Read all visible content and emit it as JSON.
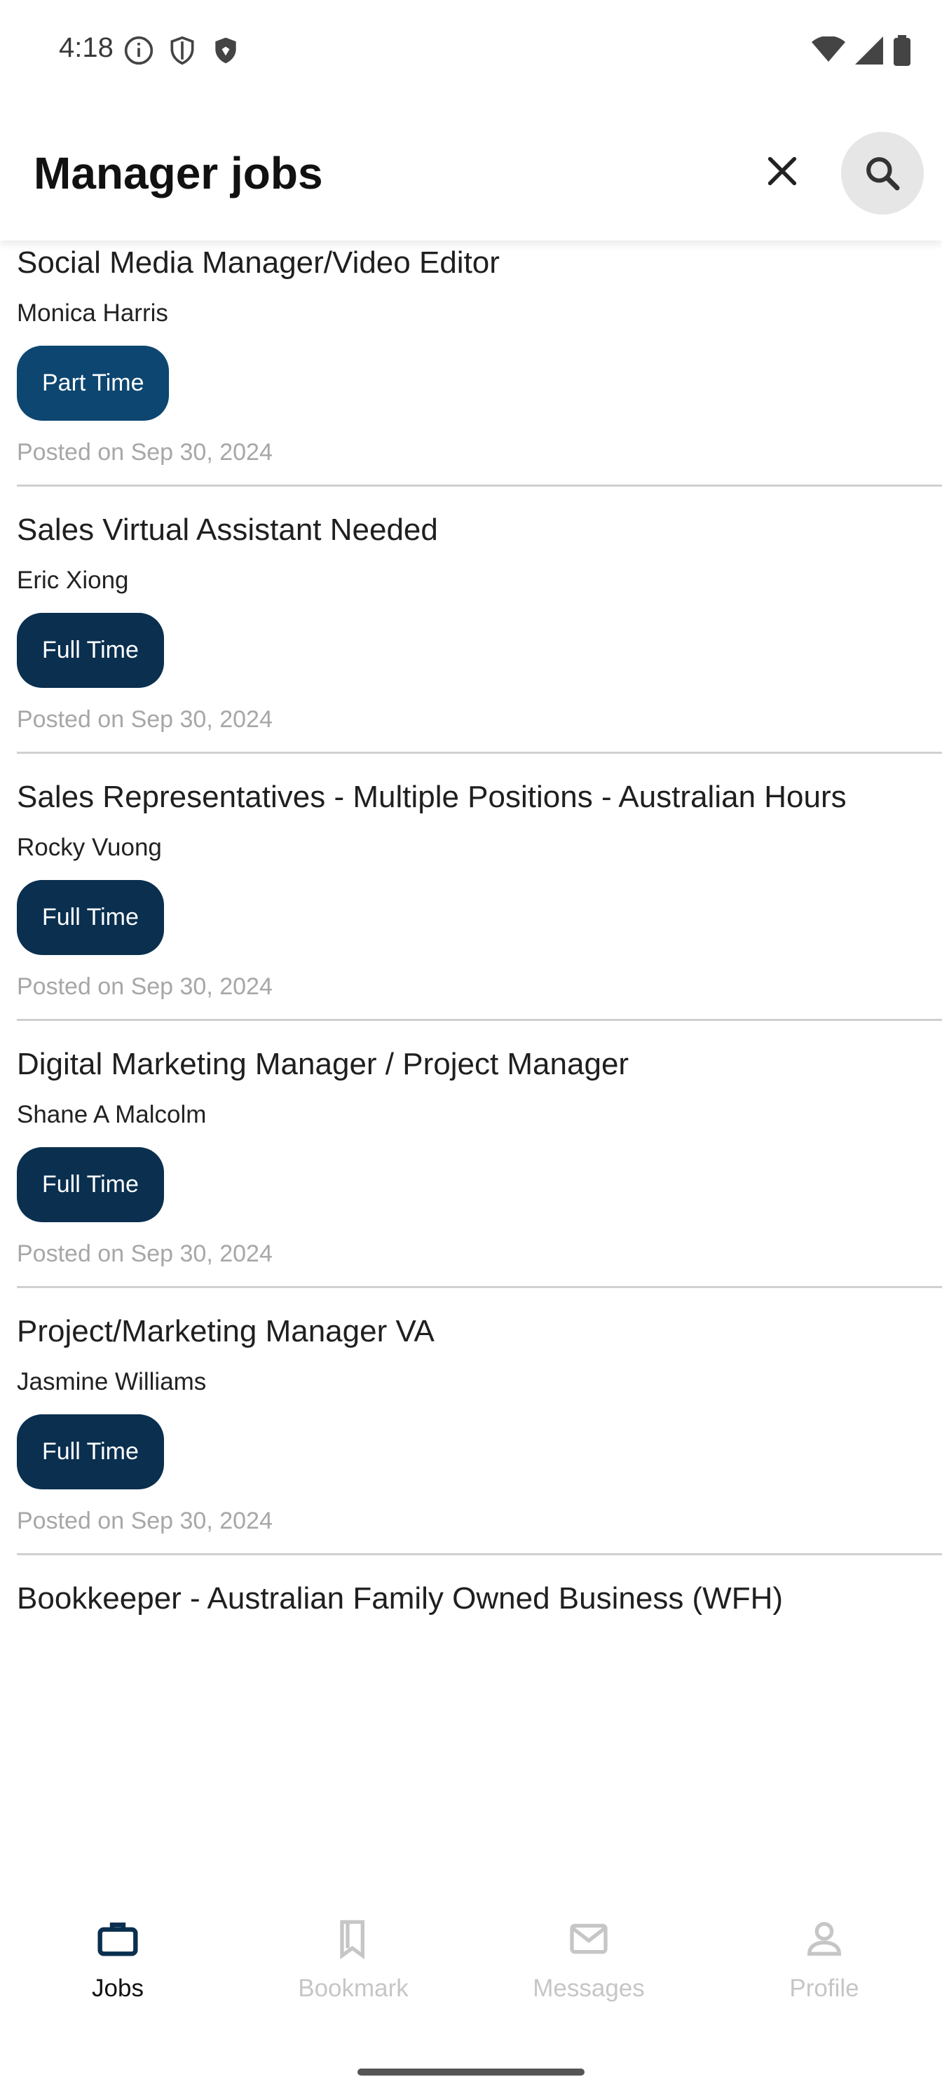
{
  "status_bar": {
    "time": "4:18",
    "icons_left": [
      "info-icon",
      "shield-outline-icon",
      "shield-filled-icon"
    ],
    "icons_right": [
      "wifi-icon",
      "signal-icon",
      "battery-icon"
    ]
  },
  "app_bar": {
    "title": "Manager jobs",
    "clear_icon": "close-icon",
    "search_icon": "search-icon"
  },
  "jobs": [
    {
      "title": "Social Media Manager/Video Editor",
      "company": "Monica Harris",
      "type": "Part Time",
      "posted": "Posted on Sep 30, 2024"
    },
    {
      "title": "Sales Virtual Assistant Needed",
      "company": "Eric Xiong",
      "type": "Full Time",
      "posted": "Posted on Sep 30, 2024"
    },
    {
      "title": "Sales Representatives - Multiple Positions - Australian Hours",
      "company": "Rocky Vuong",
      "type": "Full Time",
      "posted": "Posted on Sep 30, 2024"
    },
    {
      "title": "Digital Marketing Manager / Project Manager",
      "company": "Shane A Malcolm",
      "type": "Full Time",
      "posted": "Posted on Sep 30, 2024"
    },
    {
      "title": "Project/Marketing Manager VA",
      "company": "Jasmine Williams",
      "type": "Full Time",
      "posted": "Posted on Sep 30, 2024"
    },
    {
      "title": "Bookkeeper - Australian Family Owned Business (WFH)",
      "company": "",
      "type": "",
      "posted": ""
    }
  ],
  "bottom_nav": {
    "items": [
      {
        "label": "Jobs",
        "icon": "briefcase-icon",
        "active": true
      },
      {
        "label": "Bookmark",
        "icon": "bookmark-icon",
        "active": false
      },
      {
        "label": "Messages",
        "icon": "mail-icon",
        "active": false
      },
      {
        "label": "Profile",
        "icon": "person-icon",
        "active": false
      }
    ]
  },
  "colors": {
    "full_time_tag": "#0a2f4f",
    "part_time_tag": "#0d4670",
    "muted_text": "#a7a7a7"
  }
}
